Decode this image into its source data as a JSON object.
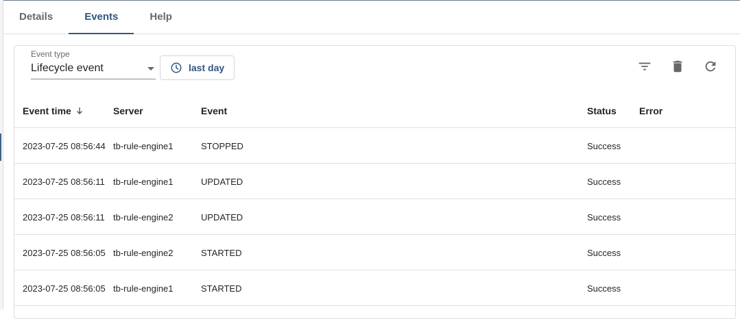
{
  "tabs": [
    {
      "label": "Details",
      "active": false
    },
    {
      "label": "Events",
      "active": true
    },
    {
      "label": "Help",
      "active": false
    }
  ],
  "filter": {
    "event_type_label": "Event type",
    "event_type_value": "Lifecycle event",
    "time_button_label": "last day",
    "time_button_icon": "clock-icon"
  },
  "toolbar": {
    "filter_icon": "filter-icon",
    "delete_icon": "delete-icon",
    "refresh_icon": "refresh-icon"
  },
  "table": {
    "columns": [
      "Event time",
      "Server",
      "Event",
      "Status",
      "Error"
    ],
    "sorted_column": "Event time",
    "sort_direction": "desc",
    "rows": [
      {
        "time": "2023-07-25 08:56:44",
        "server": "tb-rule-engine1",
        "event": "STOPPED",
        "status": "Success",
        "error": ""
      },
      {
        "time": "2023-07-25 08:56:11",
        "server": "tb-rule-engine1",
        "event": "UPDATED",
        "status": "Success",
        "error": ""
      },
      {
        "time": "2023-07-25 08:56:11",
        "server": "tb-rule-engine2",
        "event": "UPDATED",
        "status": "Success",
        "error": ""
      },
      {
        "time": "2023-07-25 08:56:05",
        "server": "tb-rule-engine2",
        "event": "STARTED",
        "status": "Success",
        "error": ""
      },
      {
        "time": "2023-07-25 08:56:05",
        "server": "tb-rule-engine1",
        "event": "STARTED",
        "status": "Success",
        "error": ""
      }
    ]
  },
  "colors": {
    "accent": "#305680",
    "divider": "#e0e0e0",
    "icon": "#666666"
  }
}
